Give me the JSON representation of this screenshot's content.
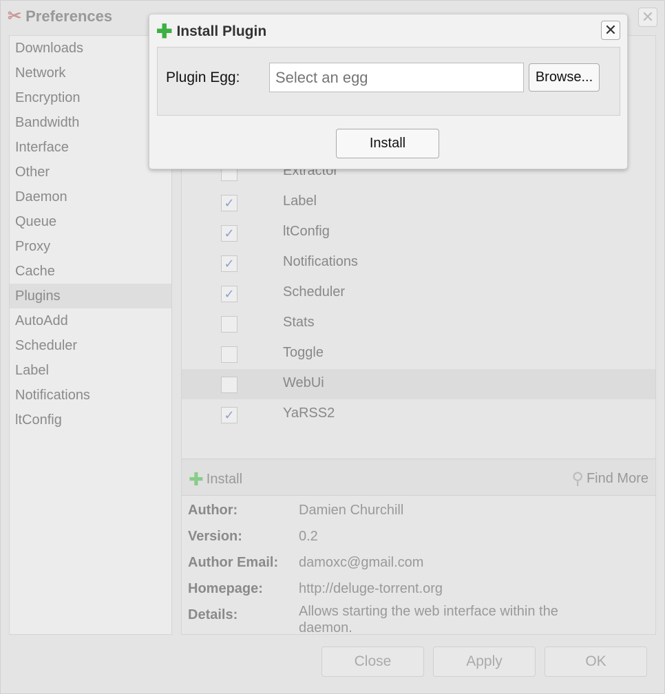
{
  "prefs": {
    "title": "Preferences",
    "icon": "tools-icon",
    "sidebar": [
      "Downloads",
      "Network",
      "Encryption",
      "Bandwidth",
      "Interface",
      "Other",
      "Daemon",
      "Queue",
      "Proxy",
      "Cache",
      "Plugins",
      "AutoAdd",
      "Scheduler",
      "Label",
      "Notifications",
      "ltConfig"
    ],
    "selected": "Plugins",
    "plugins": [
      {
        "name": "Extractor",
        "enabled": false
      },
      {
        "name": "Label",
        "enabled": true
      },
      {
        "name": "ltConfig",
        "enabled": true
      },
      {
        "name": "Notifications",
        "enabled": true
      },
      {
        "name": "Scheduler",
        "enabled": true
      },
      {
        "name": "Stats",
        "enabled": false
      },
      {
        "name": "Toggle",
        "enabled": false
      },
      {
        "name": "WebUi",
        "enabled": false,
        "highlighted": true
      },
      {
        "name": "YaRSS2",
        "enabled": true
      }
    ],
    "toolbar": {
      "install": "Install",
      "find_more": "Find More"
    },
    "info": [
      {
        "k": "Author:",
        "v": "Damien Churchill"
      },
      {
        "k": "Version:",
        "v": "0.2"
      },
      {
        "k": "Author Email:",
        "v": "damoxc@gmail.com"
      },
      {
        "k": "Homepage:",
        "v": "http://deluge-torrent.org"
      },
      {
        "k": "Details:",
        "v": "Allows starting the web interface within the daemon."
      }
    ],
    "buttons": {
      "close": "Close",
      "apply": "Apply",
      "ok": "OK"
    }
  },
  "dialog": {
    "title": "Install Plugin",
    "label": "Plugin Egg:",
    "placeholder": "Select an egg",
    "browse": "Browse...",
    "install": "Install",
    "accent": "#3cb043"
  }
}
